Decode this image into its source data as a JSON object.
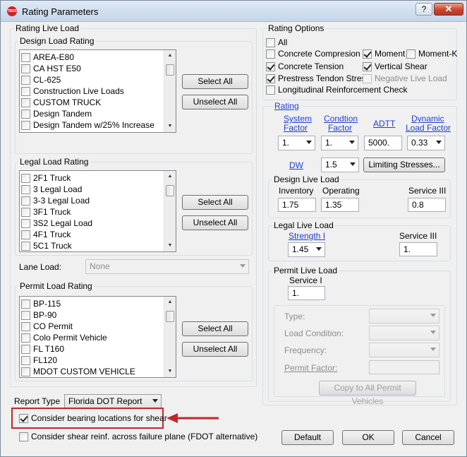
{
  "window": {
    "title": "Rating Parameters",
    "app_icon_text": "TBSS",
    "help_label": "?",
    "close_label": "✕"
  },
  "rating_live_load": {
    "group_label": "Rating Live Load",
    "design": {
      "group_label": "Design Load Rating",
      "items": [
        "AREA-E80",
        "CA HST E50",
        "CL-625",
        "Construction Live Loads",
        "CUSTOM TRUCK",
        "Design Tandem",
        "Design Tandem w/25% Increase"
      ],
      "select_all": "Select All",
      "unselect_all": "Unselect All"
    },
    "legal": {
      "group_label": "Legal Load Rating",
      "items": [
        "2F1 Truck",
        "3 Legal Load",
        "3-3 Legal Load",
        "3F1 Truck",
        "3S2 Legal Load",
        "4F1 Truck",
        "5C1 Truck"
      ],
      "select_all": "Select All",
      "unselect_all": "Unselect All"
    },
    "lane_load": {
      "label": "Lane Load:",
      "value": "None"
    },
    "permit": {
      "group_label": "Permit Load  Rating",
      "items": [
        "BP-115",
        "BP-90",
        "CO Permit",
        "Colo Permit Vehicle",
        "FL T160",
        "FL120",
        "MDOT CUSTOM VEHICLE"
      ],
      "select_all": "Select All",
      "unselect_all": "Unselect All"
    }
  },
  "report_type": {
    "label": "Report Type",
    "value": "Florida DOT Report"
  },
  "consider_bearing": {
    "label": "Consider bearing locations for shear",
    "checked": true
  },
  "consider_shear_reinf": {
    "label": "Consider shear reinf. across failure plane (FDOT alternative)",
    "checked": false
  },
  "rating_options": {
    "group_label": "Rating Options",
    "all": "All",
    "concrete_compression": "Concrete Compresion",
    "moment": "Moment",
    "moment_k": "Moment-K",
    "concrete_tension": "Concrete Tension",
    "vertical_shear": "Vertical Shear",
    "prestress_tendon": "Prestress Tendon Stress",
    "negative_live_load": "Negative Live Load",
    "longitudinal_reinf": "Longitudinal Reinforcement Check"
  },
  "rating": {
    "link": "Rating",
    "system_factor_l1": "System",
    "system_factor_l2": "Factor",
    "condition_factor_l1": "Condtion",
    "condition_factor_l2": "Factor",
    "adtt": "ADTT",
    "dynamic_l1": "Dynamic",
    "dynamic_l2": "Load Factor",
    "system_factor_value": "1.",
    "condition_factor_value": "1.",
    "adtt_value": "5000.",
    "dynamic_value": "0.33",
    "dw": "DW",
    "dw_value": "1.5",
    "limiting_stresses": "Limiting Stresses..."
  },
  "design_live_load": {
    "group_label": "Design Live Load",
    "inventory": "Inventory",
    "operating": "Operating",
    "service_iii": "Service III",
    "inventory_value": "1.75",
    "operating_value": "1.35",
    "service_iii_value": "0.8"
  },
  "legal_live_load": {
    "group_label": "Legal Live Load",
    "strength_i": "Strength I",
    "service_iii": "Service III",
    "strength_i_value": "1.45",
    "service_iii_value": "1."
  },
  "permit_live_load": {
    "group_label": "Permit Live Load",
    "service_i": "Service I",
    "service_i_value": "1.",
    "type": "Type:",
    "load_condition": "Load Condition:",
    "frequency": "Frequency:",
    "permit_factor": "Permit Factor:",
    "copy_to_all": "Copy to All Permit Vehicles"
  },
  "footer": {
    "default": "Default",
    "ok": "OK",
    "cancel": "Cancel"
  },
  "colors": {
    "highlight": "#c2272d",
    "link": "#1f3fd0"
  }
}
